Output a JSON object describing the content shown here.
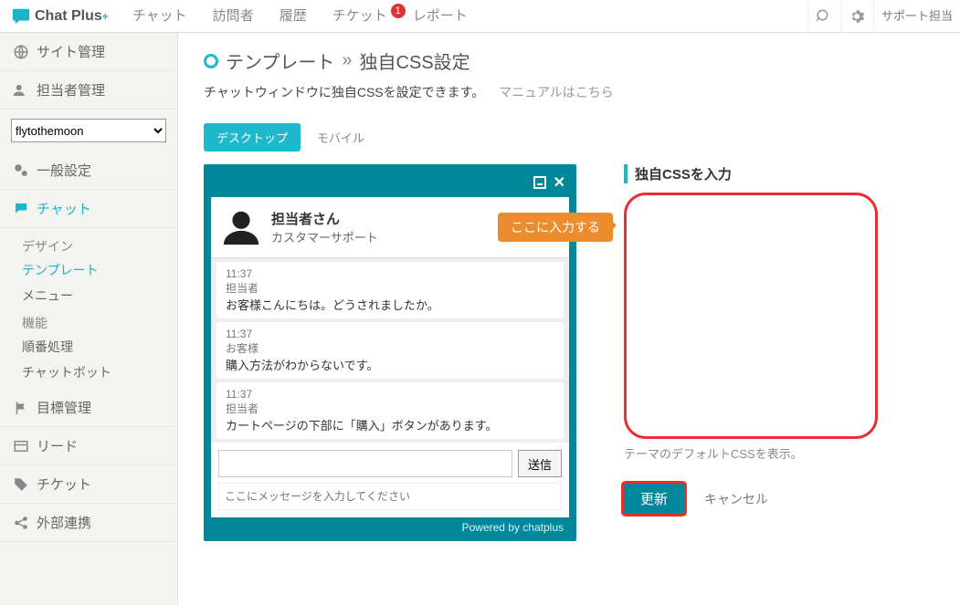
{
  "topbar": {
    "logo_text": "Chat Plus",
    "nav": {
      "chat": "チャット",
      "visitor": "訪問者",
      "history": "履歴",
      "ticket": "チケット",
      "ticket_badge": "1",
      "report": "レポート"
    },
    "support": "サポート担当"
  },
  "sidebar": {
    "site_admin": "サイト管理",
    "staff_admin": "担当者管理",
    "select_value": "flytothemoon",
    "general": "一般設定",
    "chat": "チャット",
    "chat_sub": {
      "design_hdr": "デザイン",
      "template": "テンプレート",
      "menu": "メニュー",
      "feature_hdr": "機能",
      "order": "順番処理",
      "chatbot": "チャットボット"
    },
    "goal": "目標管理",
    "lead": "リード",
    "ticket": "チケット",
    "external": "外部連携"
  },
  "page": {
    "crumb1": "テンプレート",
    "crumb2": "独自CSS設定",
    "desc": "チャットウィンドウに独自CSSを設定できます。",
    "manual": "マニュアルはこちら"
  },
  "tabs": {
    "desktop": "デスクトップ",
    "mobile": "モバイル"
  },
  "preview": {
    "agent_name": "担当者さん",
    "agent_role": "カスタマーサポート",
    "msgs": [
      {
        "time": "11:37",
        "from": "担当者",
        "body": "お客様こんにちは。どうされましたか。"
      },
      {
        "time": "11:37",
        "from": "お客様",
        "body": "購入方法がわからないです。"
      },
      {
        "time": "11:37",
        "from": "担当者",
        "body": "カートページの下部に「購入」ボタンがあります。"
      }
    ],
    "send": "送信",
    "placeholder": "ここにメッセージを入力してください",
    "powered": "Powered by chatplus"
  },
  "editor": {
    "title": "独自CSSを入力",
    "tip": "ここに入力する",
    "default_link": "テーマのデフォルトCSSを表示。",
    "update": "更新",
    "cancel": "キャンセル"
  }
}
